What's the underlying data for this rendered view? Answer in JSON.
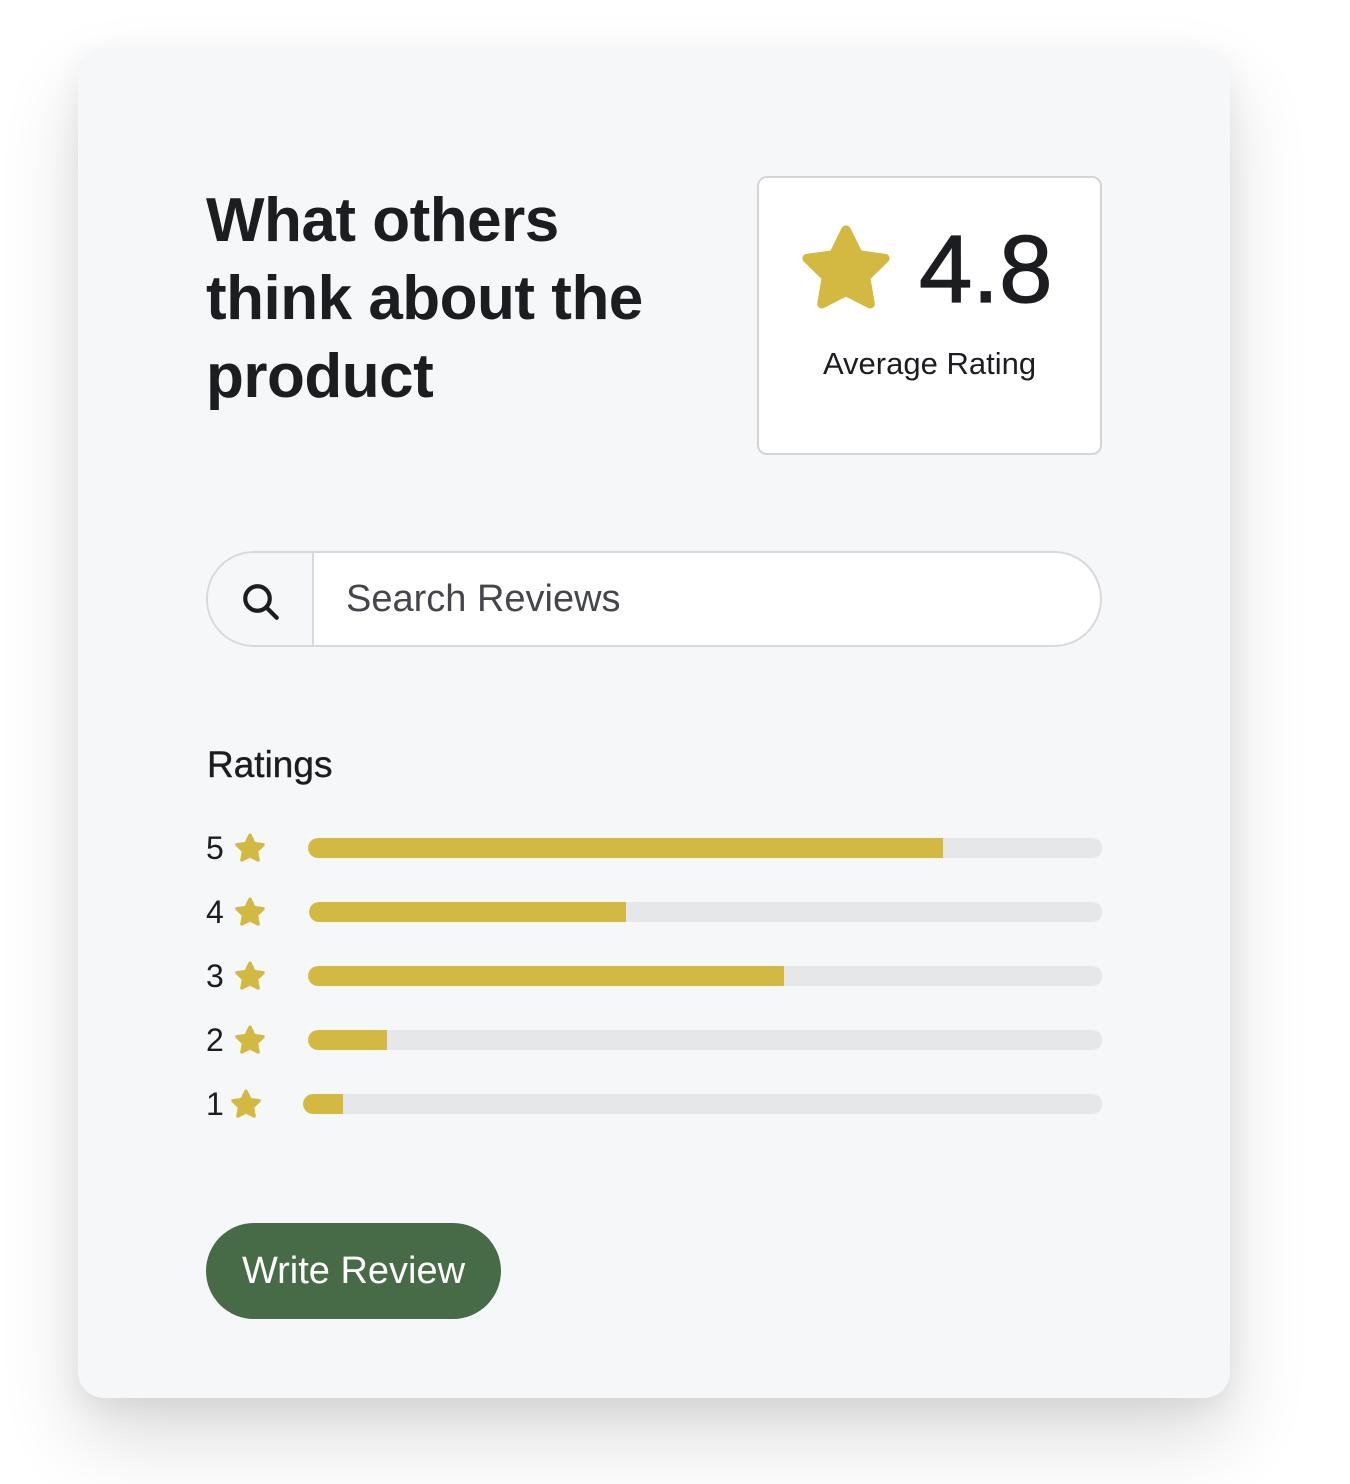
{
  "heading": "What others think about the product",
  "average": {
    "value": "4.8",
    "label": "Average Rating",
    "icon": "star-icon"
  },
  "search": {
    "placeholder": "Search Reviews",
    "icon": "search-icon"
  },
  "ratings": {
    "title": "Ratings",
    "rows": [
      {
        "stars": "5",
        "fraction": 0.8
      },
      {
        "stars": "4",
        "fraction": 0.4
      },
      {
        "stars": "3",
        "fraction": 0.6
      },
      {
        "stars": "2",
        "fraction": 0.1
      },
      {
        "stars": "1",
        "fraction": 0.05
      }
    ]
  },
  "write_button": {
    "label": "Write Review"
  },
  "colors": {
    "accent_star": "#d3b942",
    "bar_track": "#e6e7ea",
    "button_bg": "#476b47",
    "card_bg": "#f6f7f9"
  }
}
